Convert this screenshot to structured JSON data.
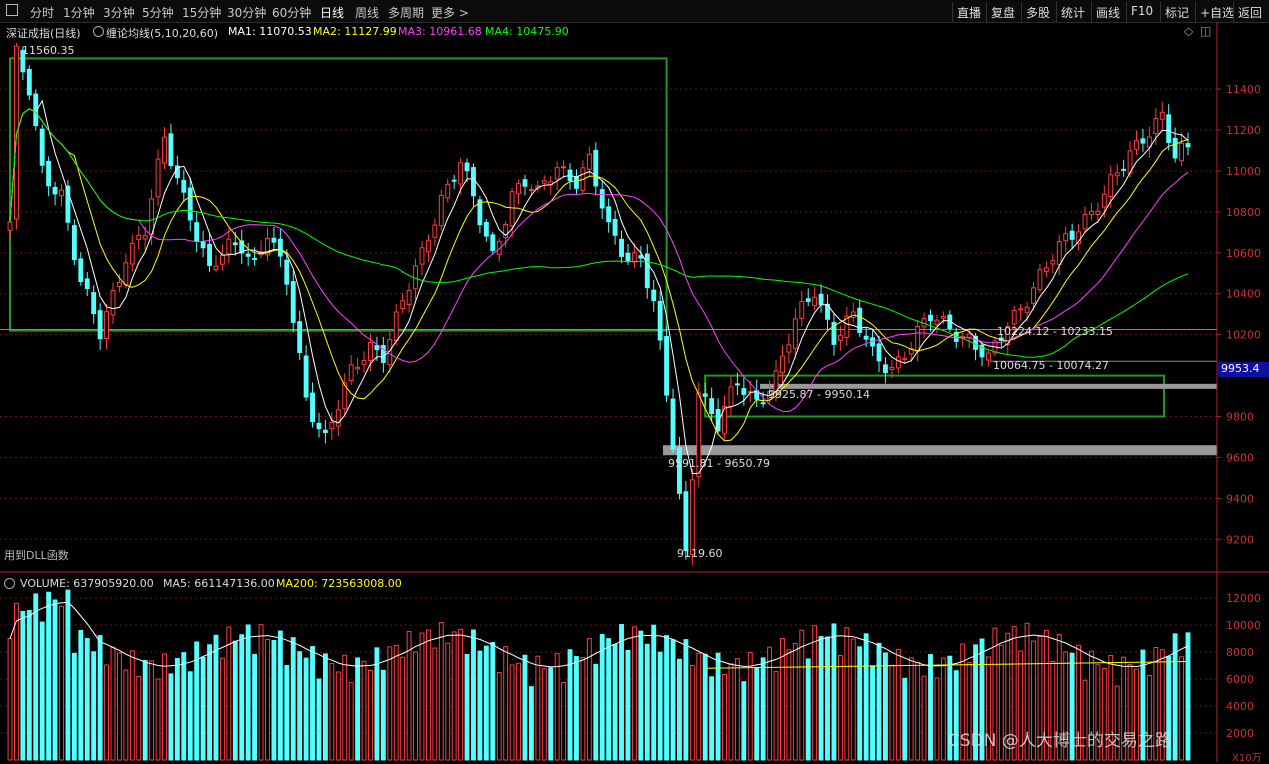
{
  "toolbar": {
    "timeframes": [
      "分时",
      "1分钟",
      "3分钟",
      "5分钟",
      "15分钟",
      "30分钟",
      "60分钟",
      "日线",
      "周线",
      "多周期",
      "更多 >"
    ],
    "active_timeframe": "日线",
    "right_buttons": [
      "直播",
      "复盘",
      "多股",
      "统计",
      "画线",
      "F10",
      "标记",
      "+自选",
      "返回"
    ]
  },
  "legend": {
    "title": "深证成指(日线)",
    "indicator": "缠论均线(5,10,20,60)",
    "ma1": "MA1: 11070.53",
    "ma2": "MA2: 11127.99",
    "ma3": "MA3: 10961.68",
    "ma4": "MA4: 10475.90"
  },
  "colors": {
    "up": "#ff3c3c",
    "down": "#54ffff",
    "ma1": "#ffffff",
    "ma2": "#ffff00",
    "ma3": "#ff40ff",
    "ma4": "#00ff00",
    "zone": "#1f9a1f",
    "axis": "#b02020",
    "grid": "#6a1414",
    "current_price_bg": "#1010a0"
  },
  "annotations": {
    "high_label": "11560.35",
    "low_label": "9119.60",
    "range1": "10224.12 - 10233.15",
    "range2": "10064.75 - 10074.27",
    "range3": "9925.87 - 9950.14",
    "range4": "9591.81 - 9650.79",
    "dll_note": "用到DLL函数",
    "current_price": "9953.4"
  },
  "volume_legend": {
    "vol": "VOLUME: 637905920.00",
    "ma5": "MA5: 661147136.00",
    "ma200": "MA200: 723563008.00"
  },
  "price_axis": {
    "ticks": [
      11400,
      11200,
      11000,
      10800,
      10600,
      10400,
      10200,
      9800,
      9600,
      9400,
      9200
    ],
    "ylim": [
      9050,
      11640
    ]
  },
  "volume_axis": {
    "ticks": [
      "12000",
      "10000",
      "8000",
      "6000",
      "4000",
      "2000"
    ],
    "unit_label": "X10万"
  },
  "watermark": "CSDN @人大博士的交易之路",
  "chart_data": {
    "type": "candlestick",
    "price_anchors": [
      [
        0,
        10750
      ],
      [
        1,
        11560
      ],
      [
        3,
        11380
      ],
      [
        5,
        11000
      ],
      [
        8,
        10900
      ],
      [
        11,
        10450
      ],
      [
        14,
        10200
      ],
      [
        18,
        10600
      ],
      [
        21,
        10700
      ],
      [
        24,
        11150
      ],
      [
        28,
        10800
      ],
      [
        31,
        10500
      ],
      [
        34,
        10620
      ],
      [
        36,
        10650
      ],
      [
        38,
        10560
      ],
      [
        40,
        10700
      ],
      [
        43,
        10450
      ],
      [
        46,
        9900
      ],
      [
        49,
        9700
      ],
      [
        53,
        10000
      ],
      [
        56,
        10150
      ],
      [
        58,
        10120
      ],
      [
        61,
        10350
      ],
      [
        64,
        10580
      ],
      [
        67,
        10880
      ],
      [
        70,
        11050
      ],
      [
        73,
        10750
      ],
      [
        75,
        10580
      ],
      [
        78,
        10900
      ],
      [
        80,
        10950
      ],
      [
        82,
        10870
      ],
      [
        85,
        11020
      ],
      [
        88,
        10970
      ],
      [
        90,
        11050
      ],
      [
        93,
        10700
      ],
      [
        96,
        10580
      ],
      [
        98,
        10600
      ],
      [
        100,
        10350
      ],
      [
        102,
        9900
      ],
      [
        105,
        9130
      ],
      [
        107,
        9950
      ],
      [
        110,
        9760
      ],
      [
        113,
        9950
      ],
      [
        116,
        9880
      ],
      [
        119,
        10000
      ],
      [
        122,
        10250
      ],
      [
        125,
        10420
      ],
      [
        128,
        10200
      ],
      [
        131,
        10280
      ],
      [
        134,
        10100
      ],
      [
        137,
        10050
      ],
      [
        140,
        10150
      ],
      [
        143,
        10280
      ],
      [
        146,
        10250
      ],
      [
        149,
        10180
      ],
      [
        152,
        10060
      ],
      [
        155,
        10260
      ],
      [
        158,
        10390
      ],
      [
        161,
        10520
      ],
      [
        164,
        10660
      ],
      [
        167,
        10780
      ],
      [
        170,
        10880
      ],
      [
        173,
        11020
      ],
      [
        176,
        11180
      ],
      [
        179,
        11280
      ],
      [
        181,
        11050
      ],
      [
        183,
        11100
      ]
    ],
    "bar_count": 184,
    "zones": [
      {
        "from": 0,
        "to": 102,
        "low": 10220,
        "high": 11550
      },
      {
        "from": 108,
        "to": 188,
        "low": 9800,
        "high": 10000
      }
    ]
  }
}
